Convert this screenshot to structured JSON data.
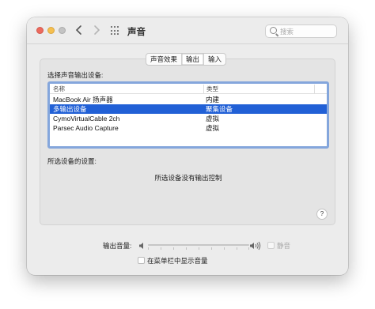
{
  "window": {
    "title": "声音",
    "search": {
      "placeholder": "搜索",
      "value": ""
    }
  },
  "tabs": [
    {
      "label": "声音效果",
      "active": false
    },
    {
      "label": "输出",
      "active": true
    },
    {
      "label": "输入",
      "active": false
    }
  ],
  "output": {
    "select_label": "选择声音输出设备:",
    "columns": [
      "名称",
      "类型"
    ],
    "devices": [
      {
        "name": "MacBook Air 扬声器",
        "type": "内建",
        "selected": false
      },
      {
        "name": "多输出设备",
        "type": "聚集设备",
        "selected": true
      },
      {
        "name": "CymoVirtualCable 2ch",
        "type": "虚拟",
        "selected": false
      },
      {
        "name": "Parsec Audio Capture",
        "type": "虚拟",
        "selected": false
      }
    ],
    "settings_label": "所选设备的设置:",
    "no_control_message": "所选设备没有输出控制",
    "help": "?"
  },
  "volume": {
    "label": "输出音量:",
    "mute_label": "静音",
    "mute_checked": false,
    "mute_enabled": false
  },
  "menubar": {
    "label": "在菜单栏中显示音量",
    "checked": false
  },
  "colors": {
    "selection": "#2160d6",
    "focus_ring": "#84a6dc",
    "close": "#ed6a5e",
    "minimize": "#f5bf4f",
    "zoom_inactive": "#c3c3c3"
  },
  "icons": [
    "back-icon",
    "forward-icon",
    "grid-icon",
    "search-icon",
    "speaker-low-icon",
    "speaker-high-icon"
  ]
}
